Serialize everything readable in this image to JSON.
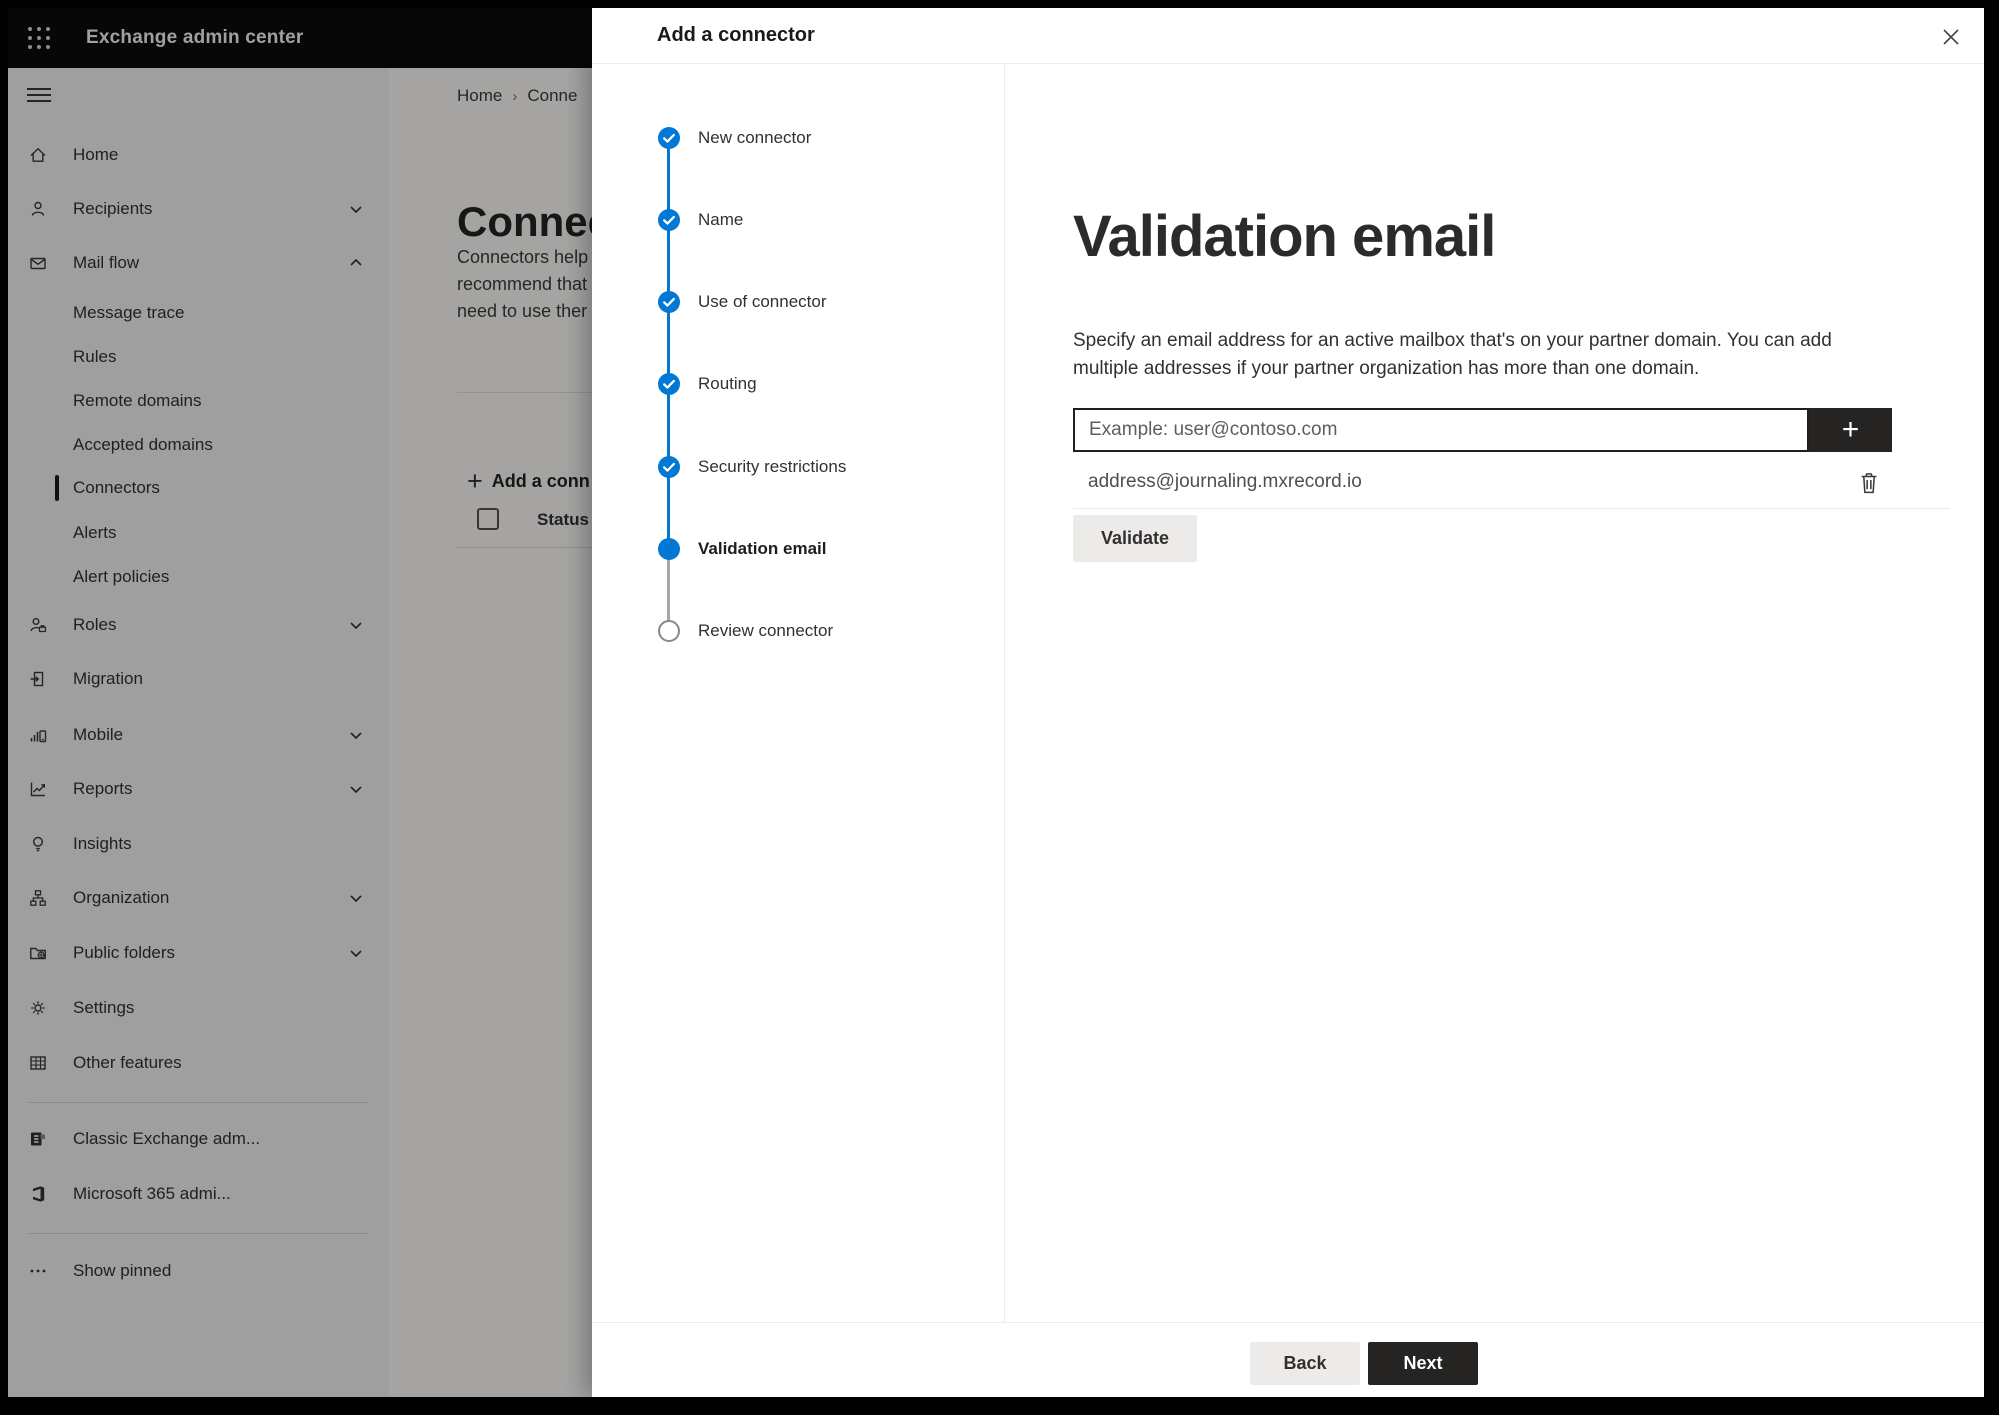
{
  "colors": {
    "accent": "#0078d4",
    "dark": "#252423",
    "light_button": "#edebe9"
  },
  "topbar": {
    "title": "Exchange admin center"
  },
  "sidebar": {
    "items": [
      {
        "label": "Home"
      },
      {
        "label": "Recipients"
      },
      {
        "label": "Mail flow"
      },
      {
        "label": "Message trace"
      },
      {
        "label": "Rules"
      },
      {
        "label": "Remote domains"
      },
      {
        "label": "Accepted domains"
      },
      {
        "label": "Connectors",
        "selected": true
      },
      {
        "label": "Alerts"
      },
      {
        "label": "Alert policies"
      },
      {
        "label": "Roles"
      },
      {
        "label": "Migration"
      },
      {
        "label": "Mobile"
      },
      {
        "label": "Reports"
      },
      {
        "label": "Insights"
      },
      {
        "label": "Organization"
      },
      {
        "label": "Public folders"
      },
      {
        "label": "Settings"
      },
      {
        "label": "Other features"
      },
      {
        "label": "Classic Exchange adm..."
      },
      {
        "label": "Microsoft 365 admi..."
      },
      {
        "label": "Show pinned"
      }
    ]
  },
  "page": {
    "breadcrumb": {
      "home": "Home",
      "separator": "›",
      "current": "Conne"
    },
    "heading": "Connec",
    "intro_line1": "Connectors help",
    "intro_line2": "recommend that",
    "intro_line3": "need to use ther",
    "add_plus": "+",
    "add_button": "Add a conn",
    "status_column": "Status"
  },
  "panel": {
    "title": "Add a connector",
    "close_icon": "✕",
    "steps": [
      {
        "label": "New connector",
        "state": "done"
      },
      {
        "label": "Name",
        "state": "done"
      },
      {
        "label": "Use of connector",
        "state": "done"
      },
      {
        "label": "Routing",
        "state": "done"
      },
      {
        "label": "Security restrictions",
        "state": "done"
      },
      {
        "label": "Validation email",
        "state": "current"
      },
      {
        "label": "Review connector",
        "state": "todo"
      }
    ],
    "content": {
      "heading": "Validation email",
      "description_line1": "Specify an email address for an active mailbox that's on your partner domain. You can add",
      "description_line2": "multiple addresses if your partner organization has more than one domain.",
      "email_input_value": "",
      "email_input_placeholder": "Example: user@contoso.com",
      "add_address_icon": "+",
      "addresses": [
        {
          "email": "address@journaling.mxrecord.io"
        }
      ],
      "validate_button": "Validate"
    },
    "footer": {
      "back_button": "Back",
      "next_button": "Next"
    }
  }
}
